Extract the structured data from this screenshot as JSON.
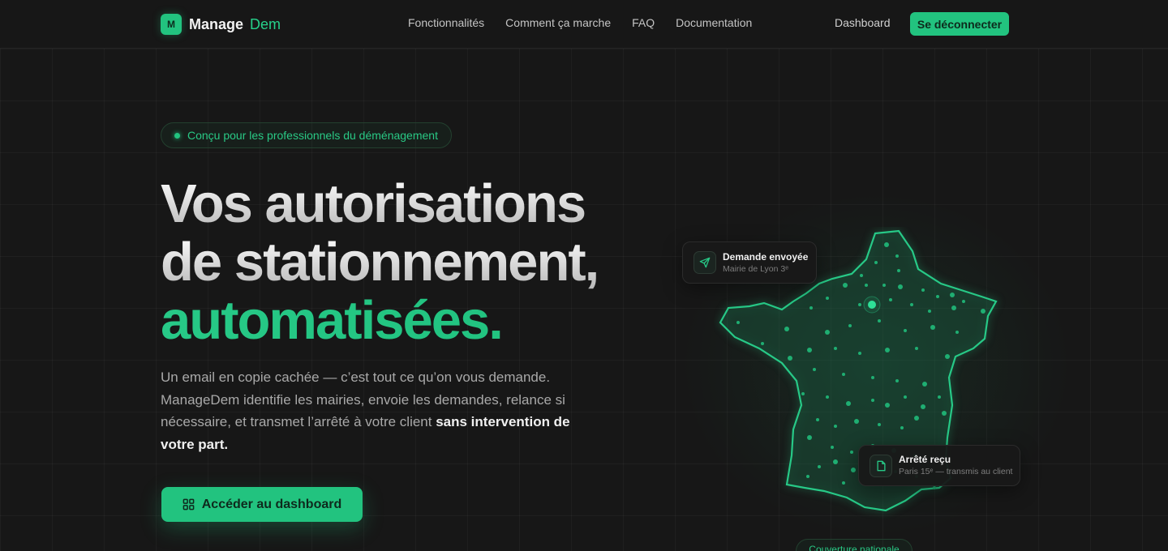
{
  "header": {
    "logo_mark": "M",
    "logo_word": "Manage",
    "logo_accent": "Dem",
    "nav": [
      {
        "label": "Fonctionnalités"
      },
      {
        "label": "Comment ça marche"
      },
      {
        "label": "FAQ"
      },
      {
        "label": "Documentation"
      }
    ],
    "dashboard_label": "Dashboard",
    "logout_label": "Se déconnecter"
  },
  "hero": {
    "badge": "Conçu pour les professionnels du déménagement",
    "title_line1": "Vos autorisations",
    "title_line2": "de stationnement,",
    "title_line3": "automatisées.",
    "lead_text": "Un email en copie cachée — c’est tout ce qu’on vous demande. ManageDem identifie les mairies, envoie les demandes, relance si nécessaire, et transmet l’arrêté à votre client ",
    "lead_emphasis": "sans intervention de votre part.",
    "cta_label": "Accéder au dashboard"
  },
  "map": {
    "card_sent": {
      "title": "Demande envoyée",
      "subtitle": "Mairie de Lyon 3ᵉ"
    },
    "card_received": {
      "title": "Arrêté reçu",
      "subtitle": "Paris 15ᵉ — transmis au client"
    },
    "coverage_label": "Couverture nationale"
  },
  "colors": {
    "accent": "#22c37f",
    "background": "#171717"
  }
}
